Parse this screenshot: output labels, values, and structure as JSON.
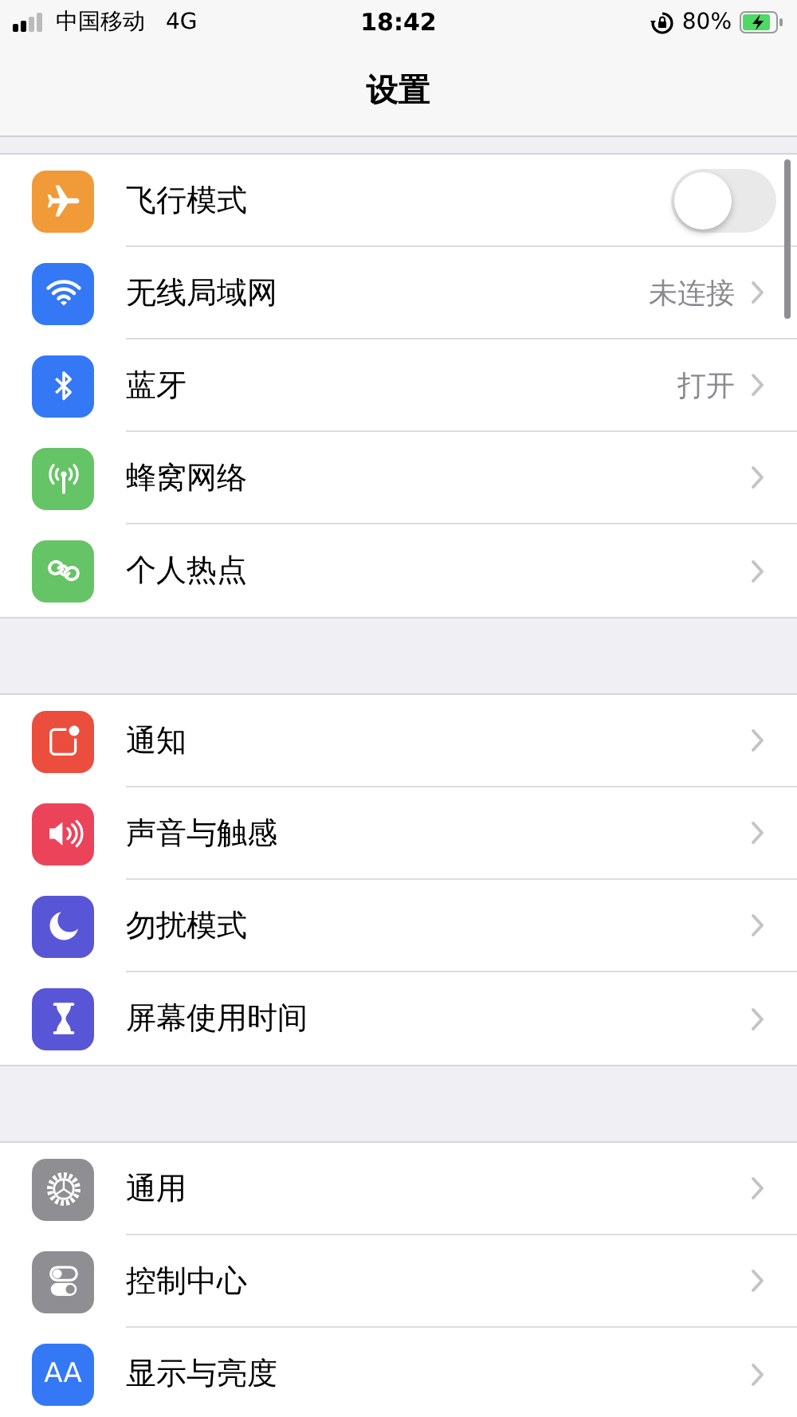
{
  "status_bar": {
    "carrier": "中国移动",
    "network": "4G",
    "time": "18:42",
    "battery": "80%"
  },
  "nav_bar": {
    "title": "设置"
  },
  "groups": [
    {
      "rows": [
        {
          "label": "飞行模式",
          "color": "#f19a38",
          "kind": "toggle",
          "on": false
        },
        {
          "label": "无线局域网",
          "color": "#3478f6",
          "kind": "link",
          "detail": "未连接"
        },
        {
          "label": "蓝牙",
          "color": "#3478f6",
          "kind": "link",
          "detail": "打开"
        },
        {
          "label": "蜂窝网络",
          "color": "#65c466",
          "kind": "link"
        },
        {
          "label": "个人热点",
          "color": "#65c466",
          "kind": "link"
        }
      ]
    },
    {
      "rows": [
        {
          "label": "通知",
          "color": "#eb4e3d",
          "kind": "link"
        },
        {
          "label": "声音与触感",
          "color": "#eb445a",
          "kind": "link"
        },
        {
          "label": "勿扰模式",
          "color": "#5856d6",
          "kind": "link"
        },
        {
          "label": "屏幕使用时间",
          "color": "#5856d6",
          "kind": "link"
        }
      ]
    },
    {
      "rows": [
        {
          "label": "通用",
          "color": "#8e8e93",
          "kind": "link"
        },
        {
          "label": "控制中心",
          "color": "#8e8e93",
          "kind": "link"
        },
        {
          "label": "显示与亮度",
          "icon_text": "AA",
          "color": "#3478f6",
          "kind": "link"
        }
      ]
    }
  ]
}
